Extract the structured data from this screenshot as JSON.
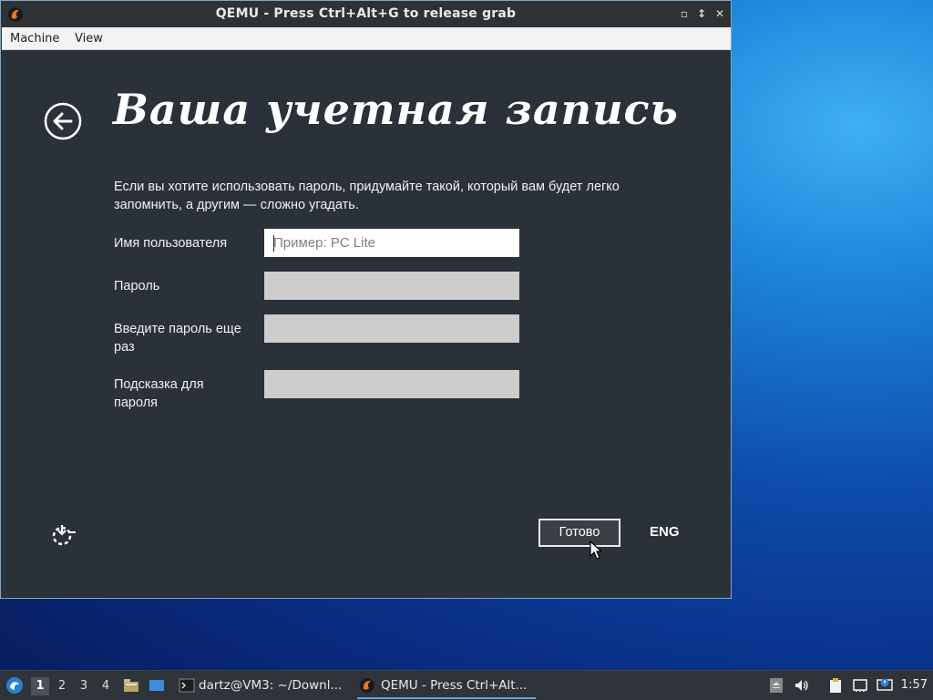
{
  "window": {
    "title": "QEMU - Press Ctrl+Alt+G to release grab",
    "menu": [
      "Machine",
      "View"
    ]
  },
  "setup": {
    "heading": "Ваша учетная запись",
    "intro": "Если вы хотите использовать пароль, придумайте такой, который вам будет легко запомнить, а другим — сложно угадать.",
    "fields": [
      {
        "label": "Имя пользователя",
        "placeholder": "Пример: PC Lite",
        "value": ""
      },
      {
        "label": "Пароль",
        "placeholder": "",
        "value": ""
      },
      {
        "label": "Введите пароль еще раз",
        "placeholder": "",
        "value": ""
      },
      {
        "label": "Подсказка для пароля",
        "placeholder": "",
        "value": ""
      }
    ],
    "done_label": "Готово",
    "language": "ENG"
  },
  "taskbar": {
    "desktops": [
      "1",
      "2",
      "3",
      "4"
    ],
    "active_desktop": "1",
    "tasks": [
      {
        "label": "dartz@VM3: ~/Downl...",
        "icon": "terminal-icon"
      },
      {
        "label": "QEMU - Press Ctrl+Alt...",
        "icon": "qemu-icon"
      }
    ],
    "clock": "1:57"
  },
  "colors": {
    "guest_bg": "#2b3138",
    "titlebar_bg": "#2e3235",
    "taskbar_bg": "#2f343a",
    "accent": "#6aa3d8"
  }
}
